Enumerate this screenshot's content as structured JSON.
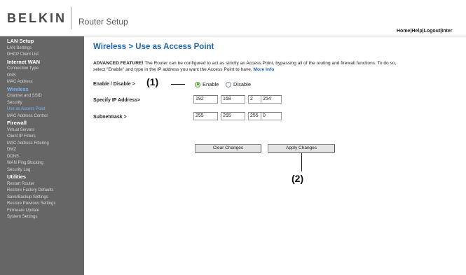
{
  "header": {
    "logo_text": "BELKIN",
    "app_title": "Router Setup",
    "links": [
      "Home",
      "Help",
      "Logout",
      "Inter"
    ],
    "separator": "|"
  },
  "sidebar": {
    "items": [
      {
        "label": "LAN Setup",
        "kind": "header"
      },
      {
        "label": "LAN Settings",
        "kind": "item"
      },
      {
        "label": "DHCP Client List",
        "kind": "item"
      },
      {
        "label": "Internet WAN",
        "kind": "header"
      },
      {
        "label": "Connection Type",
        "kind": "item"
      },
      {
        "label": "DNS",
        "kind": "item"
      },
      {
        "label": "MAC Address",
        "kind": "item"
      },
      {
        "label": "Wireless",
        "kind": "header",
        "active": true
      },
      {
        "label": "Channel and SSID",
        "kind": "item"
      },
      {
        "label": "Security",
        "kind": "item"
      },
      {
        "label": "Use as Access Point",
        "kind": "item",
        "active": true
      },
      {
        "label": "MAC Address Control",
        "kind": "item"
      },
      {
        "label": "Firewall",
        "kind": "header"
      },
      {
        "label": "Virtual Servers",
        "kind": "item"
      },
      {
        "label": "Client IP Filters",
        "kind": "item"
      },
      {
        "label": "MAC Address Filtering",
        "kind": "item"
      },
      {
        "label": "DMZ",
        "kind": "item"
      },
      {
        "label": "DDNS",
        "kind": "item"
      },
      {
        "label": "WAN Ping Blocking",
        "kind": "item"
      },
      {
        "label": "Security Log",
        "kind": "item"
      },
      {
        "label": "Utilities",
        "kind": "header"
      },
      {
        "label": "Restart Router",
        "kind": "item"
      },
      {
        "label": "Restore Factory Defaults",
        "kind": "item"
      },
      {
        "label": "Save/Backup Settings",
        "kind": "item"
      },
      {
        "label": "Restore Previous Settings",
        "kind": "item"
      },
      {
        "label": "Firmware Update",
        "kind": "item"
      },
      {
        "label": "System Settings",
        "kind": "item"
      }
    ]
  },
  "main": {
    "title": "Wireless > Use as Access Point",
    "desc_bold": "ADVANCED FEATURE!",
    "desc_text": " The Router can be configured to act as strictly an Access Point, bypassing all of the routing and firewall functions. To do so, select \"Enable\" and type in the IP address you want the Access Point to have.",
    "more_info": "More Info",
    "enable_label": "Enable / Disable >",
    "enable_option": "Enable",
    "disable_option": "Disable",
    "selected": "Enable",
    "ip_label": "Specify IP Address>",
    "ip": [
      "192",
      "168",
      "2",
      "254"
    ],
    "subnet_label": "Subnetmask >",
    "subnet": [
      "255",
      "255",
      "255",
      "0"
    ],
    "clear_button": "Clear Changes",
    "apply_button": "Apply Changes"
  },
  "callouts": {
    "one": "(1)",
    "two": "(2)"
  },
  "colors": {
    "sidebar_bg": "#666666",
    "accent_blue": "#2563a8",
    "active_nav": "#7ab3ff"
  }
}
